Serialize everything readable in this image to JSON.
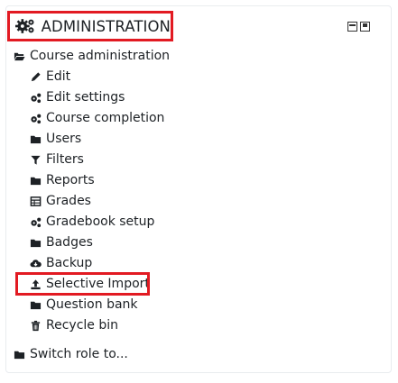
{
  "block": {
    "title": "ADMINISTRATION",
    "icon": "cogs-icon",
    "controls": [
      "collapse-icon",
      "dock-icon"
    ]
  },
  "course_admin": {
    "label": "Course administration",
    "icon": "folder-open-icon",
    "items": [
      {
        "label": "Edit",
        "icon": "pencil-icon"
      },
      {
        "label": "Edit settings",
        "icon": "cogs-icon"
      },
      {
        "label": "Course completion",
        "icon": "cogs-icon"
      },
      {
        "label": "Users",
        "icon": "folder-icon"
      },
      {
        "label": "Filters",
        "icon": "filter-icon"
      },
      {
        "label": "Reports",
        "icon": "folder-icon"
      },
      {
        "label": "Grades",
        "icon": "table-icon"
      },
      {
        "label": "Gradebook setup",
        "icon": "cogs-icon"
      },
      {
        "label": "Badges",
        "icon": "folder-icon"
      },
      {
        "label": "Backup",
        "icon": "cloud-download-icon"
      },
      {
        "label": "Selective Import",
        "icon": "upload-icon"
      },
      {
        "label": "Question bank",
        "icon": "folder-icon"
      },
      {
        "label": "Recycle bin",
        "icon": "trash-icon"
      }
    ]
  },
  "switch_role": {
    "label": "Switch role to...",
    "icon": "folder-icon"
  },
  "colors": {
    "highlight": "#e21a22",
    "text": "#1d2125"
  }
}
